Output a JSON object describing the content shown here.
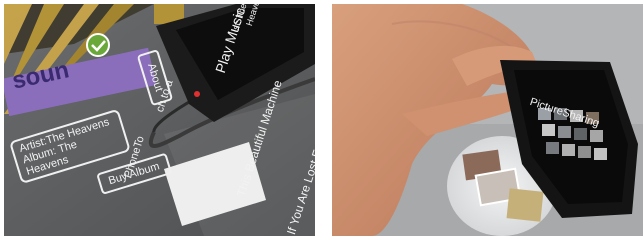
{
  "left_photo": {
    "tabletop_ui": {
      "artist_line": "Artist:The Heavens",
      "album_line": "Album: The Heavens",
      "buy_album": "Buy Album",
      "about": "About",
      "phone_hint": "PhoneTo",
      "touch_hint": "ch to a",
      "track_1": "This Beautiful Machine",
      "track_2": "If You Are Lost For Some"
    },
    "phone_screen": {
      "app_title": "Play Music",
      "line_a": "ist: The",
      "line_b": "Heaven"
    },
    "logo_fragment": "soun"
  },
  "right_photo": {
    "phone_screen": {
      "app_title": "PictureSharing"
    }
  }
}
